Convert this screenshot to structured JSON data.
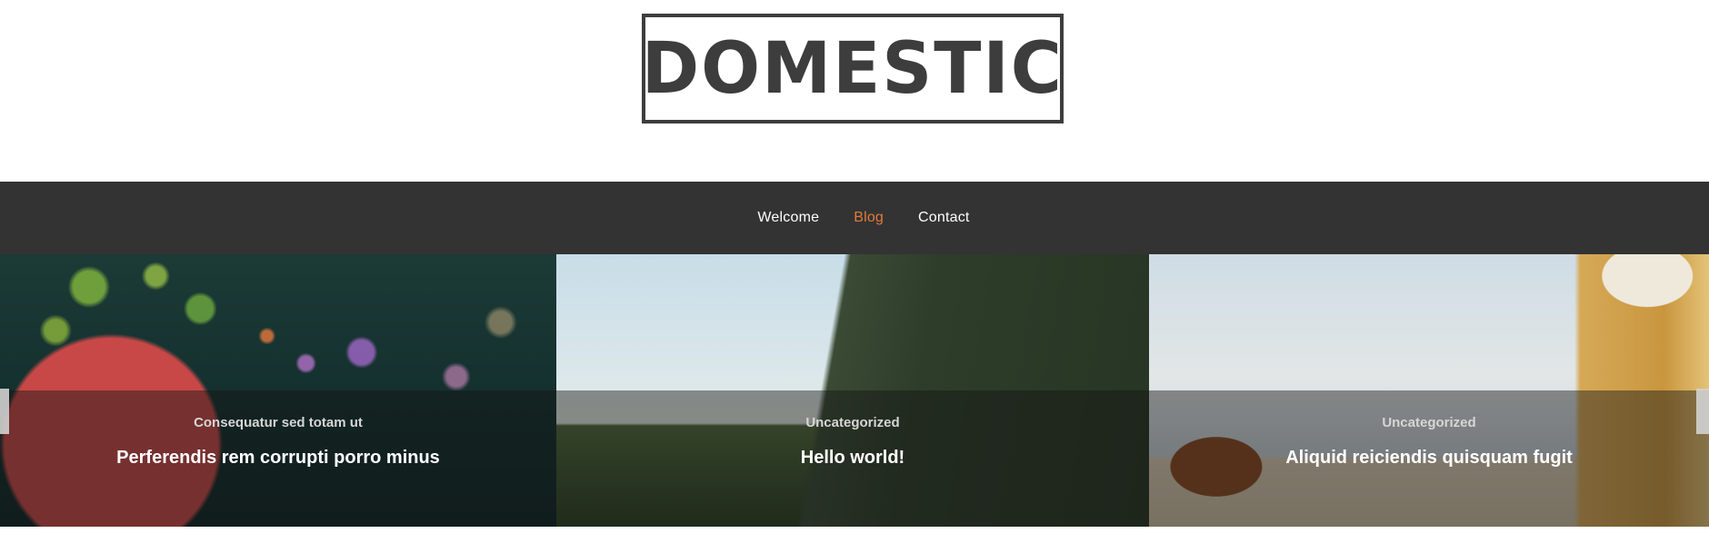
{
  "site": {
    "logo_text": "DOMESTIC"
  },
  "nav": {
    "items": [
      {
        "label": "Welcome",
        "active": false
      },
      {
        "label": "Blog",
        "active": true
      },
      {
        "label": "Contact",
        "active": false
      }
    ],
    "active_color": "#e07b3a"
  },
  "slider": {
    "slides": [
      {
        "category": "Consequatur sed totam ut",
        "title": "Perferendis rem corrupti porro minus"
      },
      {
        "category": "Uncategorized",
        "title": "Hello world!"
      },
      {
        "category": "Uncategorized",
        "title": "Aliquid reiciendis quisquam fugit"
      }
    ],
    "prev_icon": "chevron-left-icon",
    "next_icon": "chevron-right-icon"
  }
}
